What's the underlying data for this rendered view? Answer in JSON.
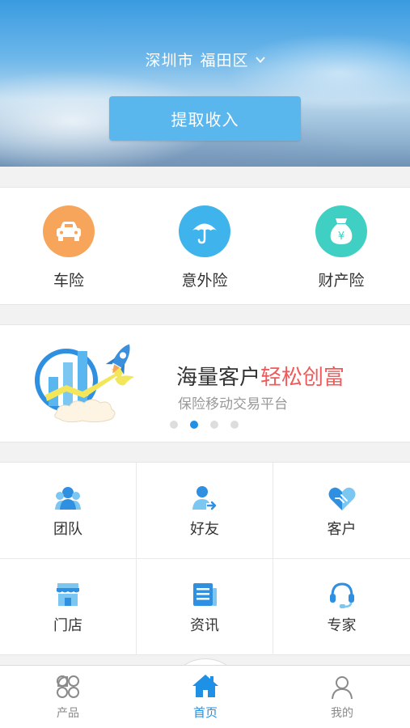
{
  "header": {
    "city": "深圳市",
    "district": "福田区",
    "withdraw_label": "提取收入"
  },
  "insurance": [
    {
      "label": "车险",
      "icon": "car-icon",
      "color": "#f6a55a"
    },
    {
      "label": "意外险",
      "icon": "umbrella-icon",
      "color": "#3fb3ec"
    },
    {
      "label": "财产险",
      "icon": "money-bag-icon",
      "color": "#3fcfc3"
    }
  ],
  "banner": {
    "title_main": "海量客户",
    "title_highlight": "轻松创富",
    "subtitle": "保险移动交易平台",
    "slide_count": 4,
    "active_slide": 2
  },
  "grid": [
    {
      "label": "团队",
      "icon": "team-icon"
    },
    {
      "label": "好友",
      "icon": "friend-icon"
    },
    {
      "label": "客户",
      "icon": "customer-icon"
    },
    {
      "label": "门店",
      "icon": "store-icon"
    },
    {
      "label": "资讯",
      "icon": "news-icon"
    },
    {
      "label": "专家",
      "icon": "expert-icon"
    }
  ],
  "tabbar": {
    "products": "产品",
    "home": "首页",
    "mine": "我的",
    "active": "home",
    "accent": "#1e90e6"
  }
}
